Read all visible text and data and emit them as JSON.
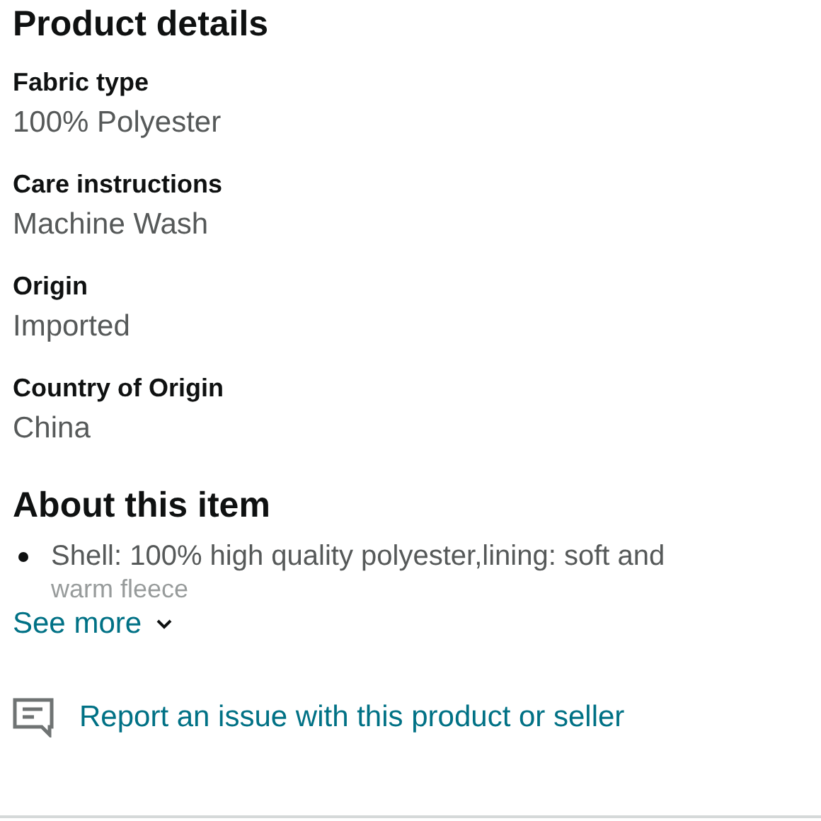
{
  "product_details": {
    "title": "Product details",
    "rows": [
      {
        "label": "Fabric type",
        "value": "100% Polyester"
      },
      {
        "label": "Care instructions",
        "value": "Machine Wash"
      },
      {
        "label": "Origin",
        "value": "Imported"
      },
      {
        "label": "Country of Origin",
        "value": "China"
      }
    ]
  },
  "about": {
    "title": "About this item",
    "bullets": [
      "Shell: 100% high quality polyester,lining: soft and"
    ],
    "faded_text": "warm fleece",
    "see_more": "See more"
  },
  "report_link": "Report an issue with this product or seller"
}
